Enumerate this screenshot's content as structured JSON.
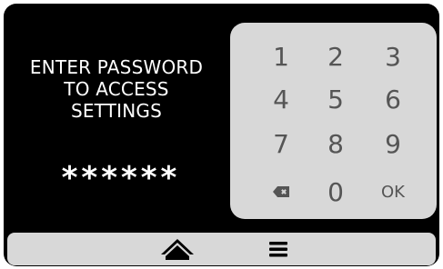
{
  "prompt": {
    "line1": "ENTER PASSWORD",
    "line2": "TO ACCESS",
    "line3": "SETTINGS"
  },
  "password_mask": "******",
  "keypad": {
    "keys": [
      "1",
      "2",
      "3",
      "4",
      "5",
      "6",
      "7",
      "8",
      "9",
      "0"
    ],
    "ok_label": "OK",
    "backspace_icon": "backspace-icon"
  },
  "navbar": {
    "home_icon": "home-icon",
    "menu_icon": "menu-icon"
  },
  "colors": {
    "screen_bg": "#000000",
    "panel_bg": "#d8d8d8",
    "key_text": "#555555",
    "text": "#ffffff"
  }
}
